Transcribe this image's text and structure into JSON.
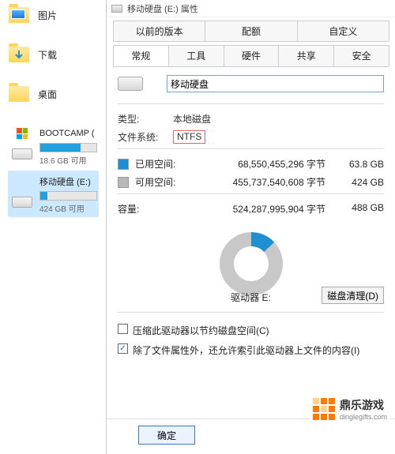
{
  "sidebar": {
    "items": [
      {
        "label": "图片",
        "icon": "pictures"
      },
      {
        "label": "下载",
        "icon": "downloads"
      },
      {
        "label": "桌面",
        "icon": "desktop"
      }
    ],
    "drives": [
      {
        "name": "BOOTCAMP (",
        "sub": "18.6 GB 可用",
        "fill_pct": 72,
        "selected": false,
        "os": true
      },
      {
        "name": "移动硬盘 (E:)",
        "sub": "424 GB 可用",
        "fill_pct": 13,
        "selected": true,
        "os": false
      }
    ]
  },
  "dialog": {
    "title": "移动硬盘 (E:) 属性",
    "tabs_row1": [
      "以前的版本",
      "配额",
      "自定义"
    ],
    "tabs_row2": [
      "常规",
      "工具",
      "硬件",
      "共享",
      "安全"
    ],
    "active_tab": "常规",
    "drive_name": "移动硬盘",
    "type_label": "类型:",
    "type_value": "本地磁盘",
    "fs_label": "文件系统:",
    "fs_value": "NTFS",
    "used_label": "已用空间:",
    "used_bytes": "68,550,455,296 字节",
    "used_h": "63.8 GB",
    "free_label": "可用空间:",
    "free_bytes": "455,737,540,608 字节",
    "free_h": "424 GB",
    "capacity_label": "容量:",
    "capacity_bytes": "524,287,995,904 字节",
    "capacity_h": "488 GB",
    "drive_letter": "驱动器 E:",
    "cleanup_button": "磁盘清理(D)",
    "compress_checkbox": "压缩此驱动器以节约磁盘空间(C)",
    "index_checkbox": "除了文件属性外，还允许索引此驱动器上文件的内容(I)",
    "ok_button": "确定"
  },
  "watermark": {
    "name": "鼎乐游戏",
    "url": "dinglegifts.com"
  }
}
